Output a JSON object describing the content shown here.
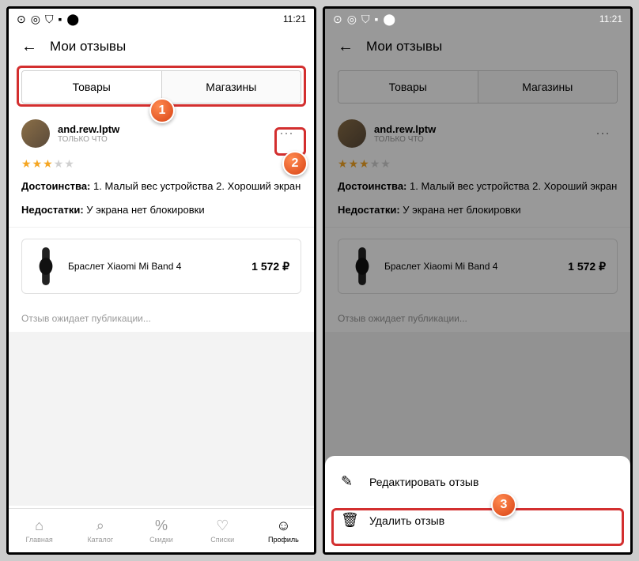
{
  "status": {
    "time": "11:21"
  },
  "header": {
    "title": "Мои отзывы"
  },
  "tabs": {
    "goods": "Товары",
    "stores": "Магазины"
  },
  "review": {
    "username": "and.rew.lptw",
    "timestamp": "ТОЛЬКО ЧТО",
    "rating": 3,
    "pros_label": "Достоинства:",
    "pros_text": " 1. Малый вес устройства 2. Хороший экран",
    "cons_label": "Недостатки:",
    "cons_text": " У экрана нет блокировки"
  },
  "product": {
    "name": "Браслет Xiaomi Mi Band 4",
    "price": "1 572 ₽"
  },
  "pending": "Отзыв ожидает публикации...",
  "nav": {
    "home": "Главная",
    "catalog": "Каталог",
    "discounts": "Скидки",
    "lists": "Списки",
    "profile": "Профиль"
  },
  "sheet": {
    "edit": "Редактировать отзыв",
    "delete": "Удалить отзыв"
  },
  "badges": {
    "b1": "1",
    "b2": "2",
    "b3": "3"
  }
}
